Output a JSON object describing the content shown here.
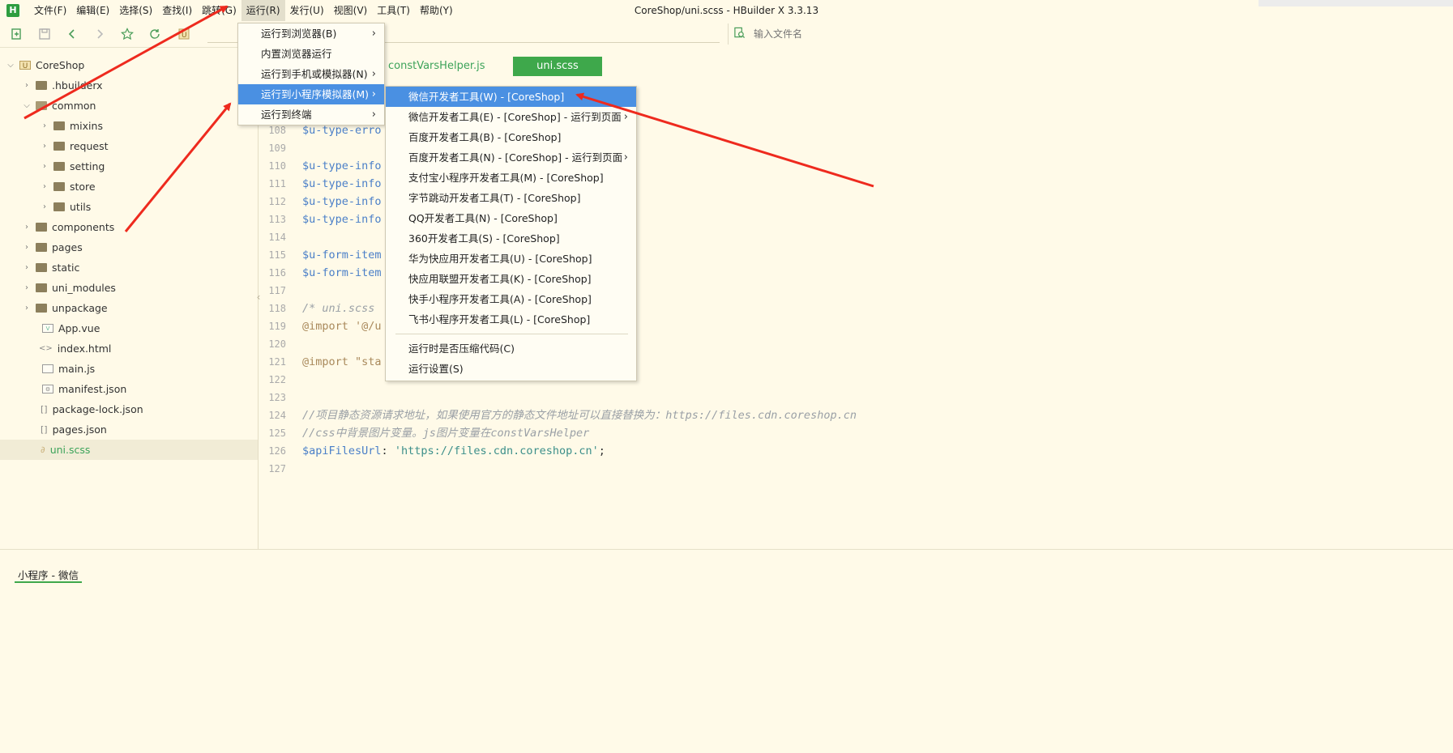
{
  "window": {
    "title": "CoreShop/uni.scss - HBuilder X 3.3.13"
  },
  "app_logo": "H",
  "menubar": {
    "items": [
      {
        "label": "文件(F)"
      },
      {
        "label": "编辑(E)"
      },
      {
        "label": "选择(S)"
      },
      {
        "label": "查找(I)"
      },
      {
        "label": "跳转(G)"
      },
      {
        "label": "运行(R)"
      },
      {
        "label": "发行(U)"
      },
      {
        "label": "视图(V)"
      },
      {
        "label": "工具(T)"
      },
      {
        "label": "帮助(Y)"
      }
    ]
  },
  "toolbar": {
    "file_search_placeholder": "输入文件名"
  },
  "sidebar": {
    "tree": [
      {
        "label": "CoreShop",
        "type": "project",
        "expanded": true
      },
      {
        "label": ".hbuilderx",
        "type": "folder",
        "expanded": false
      },
      {
        "label": "common",
        "type": "folder",
        "expanded": true
      },
      {
        "label": "mixins",
        "type": "folder",
        "expanded": false
      },
      {
        "label": "request",
        "type": "folder",
        "expanded": false
      },
      {
        "label": "setting",
        "type": "folder",
        "expanded": false
      },
      {
        "label": "store",
        "type": "folder",
        "expanded": false
      },
      {
        "label": "utils",
        "type": "folder",
        "expanded": false
      },
      {
        "label": "components",
        "type": "folder",
        "expanded": false
      },
      {
        "label": "pages",
        "type": "folder",
        "expanded": false
      },
      {
        "label": "static",
        "type": "folder",
        "expanded": false
      },
      {
        "label": "uni_modules",
        "type": "folder",
        "expanded": false
      },
      {
        "label": "unpackage",
        "type": "folder",
        "expanded": false
      },
      {
        "label": "App.vue",
        "type": "file",
        "glyph": "V"
      },
      {
        "label": "index.html",
        "type": "file",
        "glyph": "<>"
      },
      {
        "label": "main.js",
        "type": "file",
        "glyph": ""
      },
      {
        "label": "manifest.json",
        "type": "file",
        "glyph": "⚙"
      },
      {
        "label": "package-lock.json",
        "type": "file",
        "glyph": "[]"
      },
      {
        "label": "pages.json",
        "type": "file",
        "glyph": "[]"
      },
      {
        "label": "uni.scss",
        "type": "file",
        "glyph": "S",
        "selected": true
      }
    ]
  },
  "editor": {
    "tabs": [
      {
        "label": "constVarsHelper.js",
        "active": false
      },
      {
        "label": "uni.scss",
        "active": true
      }
    ],
    "lines": [
      {
        "n": "108",
        "code": "$u-type-erro",
        "kind": "var"
      },
      {
        "n": "109",
        "code": "",
        "kind": "plain"
      },
      {
        "n": "110",
        "code": "$u-type-info",
        "kind": "var"
      },
      {
        "n": "111",
        "code": "$u-type-info",
        "kind": "var"
      },
      {
        "n": "112",
        "code": "$u-type-info",
        "kind": "var"
      },
      {
        "n": "113",
        "code": "$u-type-info",
        "kind": "var"
      },
      {
        "n": "114",
        "code": "",
        "kind": "plain"
      },
      {
        "n": "115",
        "code": "$u-form-item",
        "kind": "var"
      },
      {
        "n": "116",
        "code": "$u-form-item",
        "kind": "var"
      },
      {
        "n": "117",
        "code": "",
        "kind": "plain"
      },
      {
        "n": "118",
        "code": "/* uni.scss",
        "kind": "cmt"
      },
      {
        "n": "119",
        "code": "@import '@/u",
        "kind": "kw"
      },
      {
        "n": "120",
        "code": "",
        "kind": "plain"
      },
      {
        "n": "121",
        "code": "@import \"sta",
        "kind": "kw"
      },
      {
        "n": "122",
        "code": "",
        "kind": "plain"
      },
      {
        "n": "123",
        "code": "",
        "kind": "plain"
      },
      {
        "n": "124",
        "code": "//项目静态资源请求地址，如果使用官方的静态文件地址可以直接替换为：https://files.cdn.coreshop.cn",
        "kind": "cmt"
      },
      {
        "n": "125",
        "code": "//css中背景图片变量。js图片变量在constVarsHelper",
        "kind": "cmt"
      },
      {
        "n": "126",
        "code": "",
        "kind": "apifiles"
      },
      {
        "n": "127",
        "code": "",
        "kind": "plain"
      }
    ],
    "api_line": {
      "var": "$apiFilesUrl",
      "colon": ": ",
      "value": "'https://files.cdn.coreshop.cn'",
      "end": ";"
    }
  },
  "run_menu": {
    "items": [
      {
        "label": "运行到浏览器(B)",
        "submenu": true
      },
      {
        "label": "内置浏览器运行",
        "submenu": false
      },
      {
        "label": "运行到手机或模拟器(N)",
        "submenu": true
      },
      {
        "label": "运行到小程序模拟器(M)",
        "submenu": true,
        "highlight": true
      },
      {
        "label": "运行到终端",
        "submenu": true
      }
    ]
  },
  "miniprogram_submenu": {
    "items": [
      {
        "label": "微信开发者工具(W) - [CoreShop]",
        "highlight": true
      },
      {
        "label": "微信开发者工具(E) - [CoreShop] - 运行到页面",
        "submenu": true
      },
      {
        "label": "百度开发者工具(B) - [CoreShop]"
      },
      {
        "label": "百度开发者工具(N) - [CoreShop] - 运行到页面",
        "submenu": true
      },
      {
        "label": "支付宝小程序开发者工具(M) - [CoreShop]"
      },
      {
        "label": "字节跳动开发者工具(T) - [CoreShop]"
      },
      {
        "label": "QQ开发者工具(N) - [CoreShop]"
      },
      {
        "label": "360开发者工具(S) - [CoreShop]"
      },
      {
        "label": "华为快应用开发者工具(U) - [CoreShop]"
      },
      {
        "label": "快应用联盟开发者工具(K) - [CoreShop]"
      },
      {
        "label": "快手小程序开发者工具(A) - [CoreShop]"
      },
      {
        "label": "飞书小程序开发者工具(L) - [CoreShop]"
      }
    ],
    "footer_items": [
      {
        "label": "运行时是否压缩代码(C)"
      },
      {
        "label": "运行设置(S)"
      }
    ]
  },
  "bottom_panel": {
    "tab_label": "小程序 - 微信"
  },
  "colors": {
    "accent_green": "#3ea84b",
    "menu_highlight": "#4a90e2",
    "annotation_red": "#ee2a1e"
  }
}
